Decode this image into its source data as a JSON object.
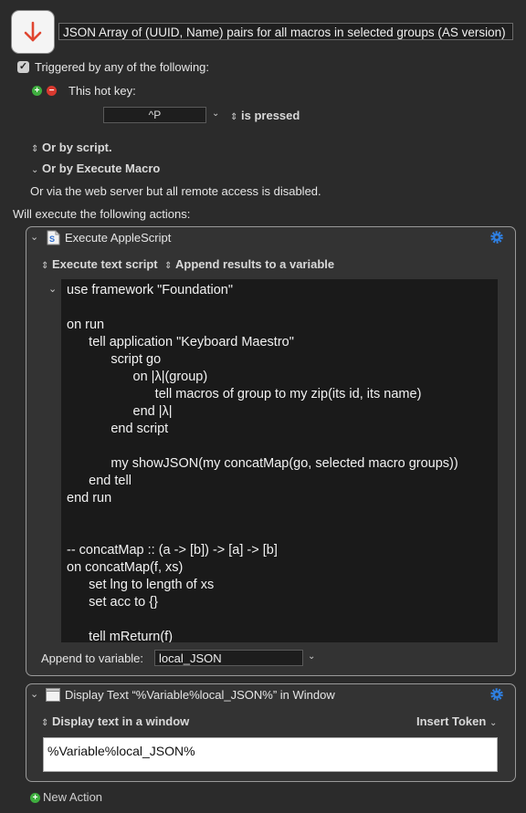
{
  "macro": {
    "title": "JSON Array of (UUID, Name) pairs for all macros in selected groups (AS version)"
  },
  "triggers": {
    "header": "Triggered by any of the following:",
    "hotkey_label": "This hot key:",
    "hotkey_value": "^P",
    "hotkey_condition": "is pressed",
    "or_script": "Or by script.",
    "or_execute_macro": "Or by Execute Macro",
    "web_server_note": "Or via the web server but all remote access is disabled."
  },
  "actions_header": "Will execute the following actions:",
  "action1": {
    "title": "Execute AppleScript",
    "execute_mode": "Execute text script",
    "result_mode": "Append results to a variable",
    "script_lines": [
      "use framework \"Foundation\"",
      "",
      "on run",
      "      tell application \"Keyboard Maestro\"",
      "            script go",
      "                  on |λ|(group)",
      "                        tell macros of group to my zip(its id, its name)",
      "                  end |λ|",
      "            end script",
      "",
      "            my showJSON(my concatMap(go, selected macro groups))",
      "      end tell",
      "end run",
      "",
      "",
      "-- concatMap :: (a -> [b]) -> [a] -> [b]",
      "on concatMap(f, xs)",
      "      set lng to length of xs",
      "      set acc to {}",
      "",
      "      tell mReturn(f)"
    ],
    "append_label": "Append to variable:",
    "variable_name": "local_JSON"
  },
  "action2": {
    "title": "Display Text “%Variable%local_JSON%” in Window",
    "mode": "Display text in a window",
    "insert_token": "Insert Token",
    "text": "%Variable%local_JSON%"
  },
  "footer": {
    "new_action": "New Action"
  },
  "colors": {
    "background": "#2b2b2b",
    "accent_red": "#e0452f",
    "add_green": "#3fae3f",
    "remove_red": "#d8392f",
    "gear_blue": "#2f7fe0"
  },
  "icons": {
    "macro": "down-arrow-icon",
    "script_action": "applescript-icon",
    "display_action": "window-icon",
    "settings": "gear-icon"
  }
}
